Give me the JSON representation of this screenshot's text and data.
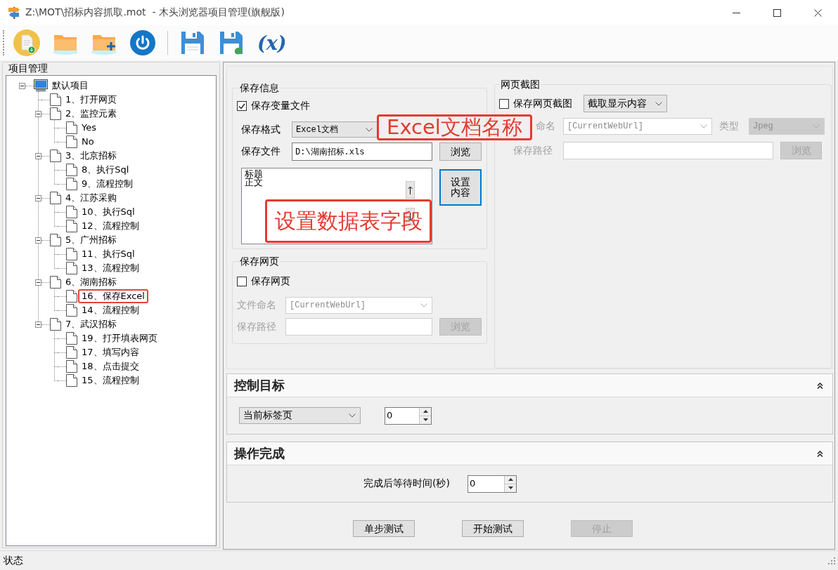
{
  "window": {
    "title": "Z:\\MOT\\招标内容抓取.mot  - 木头浏览器项目管理(旗舰版)"
  },
  "toolbar": {
    "variables_label": "(x)"
  },
  "project_panel": {
    "title": "项目管理",
    "tree": [
      {
        "label": "默认项目",
        "kind": "project",
        "expanded": true,
        "marked": false,
        "children": [
          {
            "label": "1、打开网页",
            "kind": "step",
            "marked": false
          },
          {
            "label": "2、监控元素",
            "kind": "step",
            "expanded": true,
            "marked": false,
            "children": [
              {
                "label": "Yes",
                "kind": "step",
                "marked": false
              },
              {
                "label": "No",
                "kind": "step",
                "marked": false
              }
            ]
          },
          {
            "label": "3、北京招标",
            "kind": "step",
            "expanded": true,
            "marked": false,
            "children": [
              {
                "label": "8、执行Sql",
                "kind": "step",
                "marked": false
              },
              {
                "label": "9、流程控制",
                "kind": "step",
                "marked": false
              }
            ]
          },
          {
            "label": "4、江苏采购",
            "kind": "step",
            "expanded": true,
            "marked": false,
            "children": [
              {
                "label": "10、执行Sql",
                "kind": "step",
                "marked": false
              },
              {
                "label": "12、流程控制",
                "kind": "step",
                "marked": false
              }
            ]
          },
          {
            "label": "5、广州招标",
            "kind": "step",
            "expanded": true,
            "marked": false,
            "children": [
              {
                "label": "11、执行Sql",
                "kind": "step",
                "marked": false
              },
              {
                "label": "13、流程控制",
                "kind": "step",
                "marked": false
              }
            ]
          },
          {
            "label": "6、湖南招标",
            "kind": "step",
            "expanded": true,
            "marked": false,
            "children": [
              {
                "label": "16、保存Excel",
                "kind": "step",
                "marked": true
              },
              {
                "label": "14、流程控制",
                "kind": "step",
                "marked": false
              }
            ]
          },
          {
            "label": "7、武汉招标",
            "kind": "step",
            "expanded": true,
            "marked": false,
            "children": [
              {
                "label": "19、打开填表网页",
                "kind": "step",
                "marked": false
              },
              {
                "label": "17、填写内容",
                "kind": "step",
                "marked": false
              },
              {
                "label": "18、点击提交",
                "kind": "step",
                "marked": false
              },
              {
                "label": "15、流程控制",
                "kind": "step",
                "marked": false
              }
            ]
          }
        ]
      }
    ]
  },
  "save_info": {
    "title": "保存信息",
    "save_variables": {
      "label": "保存变量文件",
      "checked": true
    },
    "format": {
      "label": "保存格式",
      "value": "Excel文档"
    },
    "file": {
      "label": "保存文件",
      "value": "D:\\湖南招标.xls"
    },
    "browse_button": {
      "label": "浏览",
      "disabled": false
    },
    "fields": [
      "标题",
      "正文"
    ],
    "set_content_button": {
      "label": "设置内容",
      "focused": true
    }
  },
  "save_page": {
    "title": "保存网页",
    "save_page": {
      "label": "保存网页",
      "checked": false
    },
    "naming": {
      "label": "文件命名",
      "value": "[CurrentWebUrl]",
      "disabled": true
    },
    "path": {
      "label": "保存路径",
      "disabled": true
    },
    "browse_button": {
      "label": "浏览",
      "disabled": true
    }
  },
  "screenshot": {
    "title": "网页截图",
    "save_screenshot": {
      "label": "保存网页截图",
      "checked": false
    },
    "capture_mode": {
      "value": "截取显示内容"
    },
    "naming": {
      "label": "命名",
      "value": "[CurrentWebUrl]",
      "disabled": true
    },
    "type": {
      "label": "类型",
      "value": "Jpeg",
      "disabled": true
    },
    "path": {
      "label": "保存路径",
      "disabled": true
    },
    "browse_button": {
      "label": "浏览",
      "disabled": true
    }
  },
  "target": {
    "title": "控制目标",
    "expanded": true,
    "tab": {
      "value": "当前标签页"
    },
    "index": {
      "value": "0"
    }
  },
  "finish": {
    "title": "操作完成",
    "expanded": true,
    "wait": {
      "label": "完成后等待时间(秒)",
      "value": "0"
    }
  },
  "actions": [
    {
      "label": "单步测试",
      "disabled": false
    },
    {
      "label": "开始测试",
      "disabled": false
    },
    {
      "label": "停止",
      "disabled": true
    }
  ],
  "status_bar": {
    "text": "状态"
  },
  "annotations": [
    {
      "text": "Excel文档名称"
    },
    {
      "text": "设置数据表字段"
    }
  ]
}
